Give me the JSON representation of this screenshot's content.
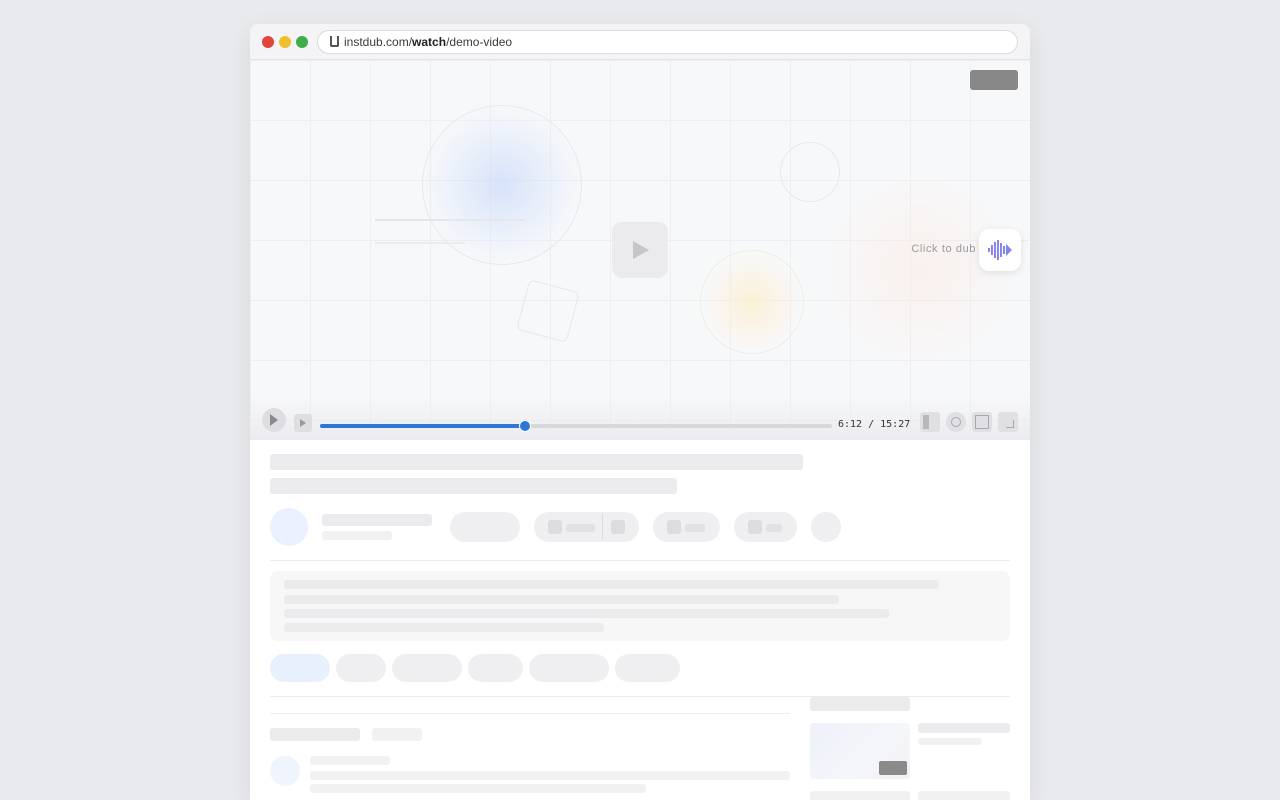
{
  "browser": {
    "url_prefix": "instdub.com/",
    "url_bold": "watch",
    "url_suffix": "/demo-video"
  },
  "video": {
    "dub_label": "Click to dub",
    "time_display": "6:12 / 15:27",
    "progress_fraction": 0.4
  },
  "colors": {
    "progress": "#2f77d6",
    "close": "#e2443b",
    "minimize": "#f0c02c",
    "maximize": "#3fae49"
  }
}
